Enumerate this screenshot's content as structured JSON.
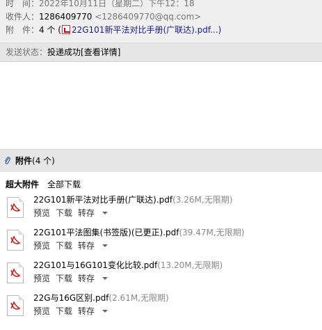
{
  "header": {
    "time_label": "时　间：",
    "time_value": "2022年10月11日（星期二）下午12：18",
    "recipient_label": "收件人：",
    "recipient_name": "1286409770",
    "recipient_email": "<1286409770@qq.com>",
    "attach_label": "附　件：",
    "attach_count": "4 个 (",
    "attach_first": "22G101新平法对比手册(广联达).pdf...)"
  },
  "status": {
    "label": "发送状态：",
    "value": "投递成功",
    "details_link": "[查看详情]"
  },
  "attachments_bar": {
    "title": "附件",
    "count": "(4 个)"
  },
  "tabs": {
    "large": "超大附件",
    "download_all": "全部下载"
  },
  "actions": {
    "preview": "预览",
    "download": "下载",
    "save_to": "转存"
  },
  "files": [
    {
      "name": "22G101新平法对比手册(广联达).pdf",
      "meta": "(3.26M,无限期)"
    },
    {
      "name": "22G101平法图集(书签版)(已更正).pdf",
      "meta": "(39.47M,无限期)"
    },
    {
      "name": "22G101与16G101变化比较.pdf",
      "meta": "(13.20M,无限期)"
    },
    {
      "name": "22G与16G区别.pdf",
      "meta": "(2.61M,无限期)"
    }
  ]
}
